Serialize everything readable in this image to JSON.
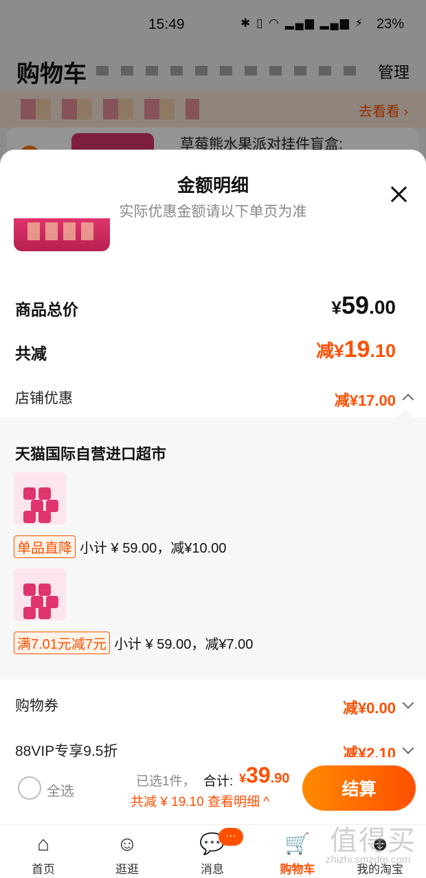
{
  "status_bar": {
    "time": "15:49",
    "battery": "23%"
  },
  "cart_page": {
    "title": "购物车",
    "manage": "管理",
    "promo_link": "去看看 ›",
    "product_title": "草莓熊水果派对挂件盲盒;"
  },
  "sheet": {
    "title": "金额明细",
    "subtitle": "实际优惠金额请以下单页为准",
    "total_label": "商品总价",
    "total_currency": "¥",
    "total_int": "59",
    "total_dec": ".00",
    "discount_label": "共减",
    "discount_prefix": "减¥",
    "discount_int": "19",
    "discount_dec": ".10",
    "store_promo_label": "店铺优惠",
    "store_promo_value": "减¥17.00",
    "shop_name": "天猫国际自营进口超市",
    "items": [
      {
        "tag": "单品直降",
        "text": "小计 ¥ 59.00，减¥10.00"
      },
      {
        "tag": "满7.01元减7元",
        "text": "小计 ¥ 59.00，减¥7.00"
      }
    ],
    "coupon_label": "购物券",
    "coupon_value": "减¥0.00",
    "vip_label": "88VIP专享9.5折",
    "vip_value": "减¥2.10"
  },
  "checkout": {
    "select_all": "全选",
    "selected_count": "已选1件，",
    "total_label": "合计:",
    "currency": "¥",
    "total_int": "39",
    "total_dec": ".90",
    "save_line": "共减 ¥ 19.10  查看明细 ^",
    "button": "结算"
  },
  "tabs": [
    {
      "label": "首页",
      "icon": "home-icon"
    },
    {
      "label": "逛逛",
      "icon": "explore-icon"
    },
    {
      "label": "消息",
      "icon": "message-icon",
      "badge": "···"
    },
    {
      "label": "购物车",
      "icon": "cart-icon",
      "active": true
    },
    {
      "label": "我的淘宝",
      "icon": "profile-icon"
    }
  ],
  "watermark": {
    "main": "值得买",
    "sub": "zhizhi.smzdm.com"
  },
  "colors": {
    "accent": "#ff5000",
    "discount": "#ff4f00",
    "sheet_bg": "#ffffff",
    "panel_bg": "#f7f7f7"
  }
}
